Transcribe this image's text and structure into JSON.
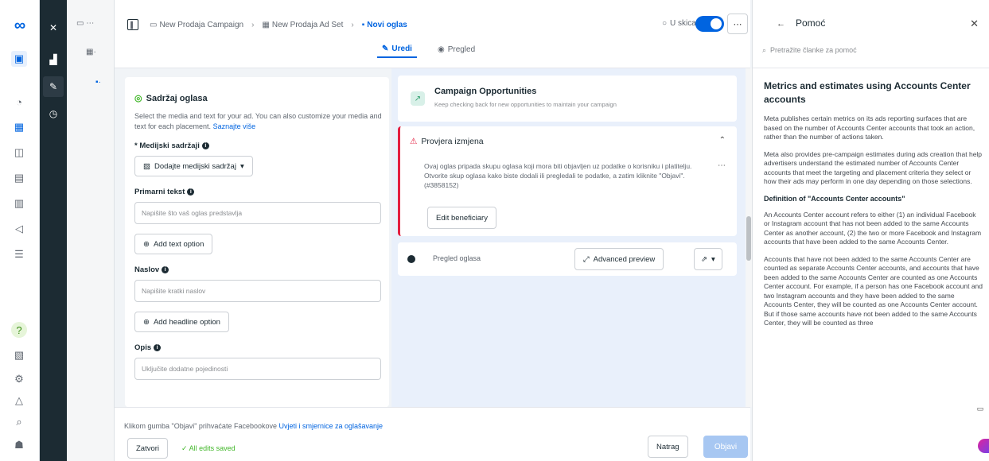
{
  "breadcrumb": {
    "campaign": "New Prodaja Campaign",
    "ad_set": "New Prodaja Ad Set",
    "ad": "Novi oglas"
  },
  "status": {
    "draft": "U skicama"
  },
  "modes": {
    "edit": "Uredi",
    "preview": "Pregled"
  },
  "editor": {
    "section_title": "Sadržaj oglasa",
    "description": "Select the media and text for your ad. You can also customize your media and text for each placement.",
    "learn_more": "Saznajte više",
    "media_label": "* Medijski sadržaji",
    "media_button": "Dodajte medijski sadržaj",
    "primary_label": "Primarni tekst",
    "primary_placeholder": "Napišite što vaš oglas predstavlja",
    "add_text": "Add text option",
    "headline_label": "Naslov",
    "headline_placeholder": "Napišite kratki naslov",
    "add_headline": "Add headline option",
    "desc_label": "Opis",
    "desc_placeholder": "Uključite dodatne pojedinosti"
  },
  "bottom": {
    "terms_prefix": "Klikom gumba \"Objavi\" prihvaćate Facebookove ",
    "terms_link": "Uvjeti i smjernice za oglašavanje",
    "close": "Zatvori",
    "saved": "All edits saved",
    "back": "Natrag",
    "publish": "Objavi"
  },
  "preview": {
    "opps_title": "Campaign Opportunities",
    "opps_desc": "Keep checking back for new opportunities to maintain your campaign",
    "review_title": "Provjera izmjena",
    "review_text": "Ovaj oglas pripada skupu oglasa koji mora biti objavljen uz podatke o korisniku i platitelju. Otvorite skup oglasa kako biste dodali ili pregledali te podatke, a zatim kliknite \"Objavi\". (#3858152)",
    "edit_beneficiary": "Edit beneficiary",
    "preview_label": "Pregled oglasa",
    "advanced_preview": "Advanced preview"
  },
  "help": {
    "title": "Pomoć",
    "search_placeholder": "Pretražite članke za pomoć",
    "heading": "Metrics and estimates using Accounts Center accounts",
    "p1": "Meta publishes certain metrics on its ads reporting surfaces that are based on the number of Accounts Center accounts that took an action, rather than the number of actions taken.",
    "p2": "Meta also provides pre-campaign estimates during ads creation that help advertisers understand the estimated number of Accounts Center accounts that meet the targeting and placement criteria they select or how their ads may perform in one day depending on those selections.",
    "subheading": "Definition of \"Accounts Center accounts\"",
    "p3": "An Accounts Center account refers to either (1) an individual Facebook or Instagram account that has not been added to the same Accounts Center as another account, (2) the two or more Facebook and Instagram accounts that have been added to the same Accounts Center.",
    "p4": "Accounts that have not been added to the same Accounts Center are counted as separate Accounts Center accounts, and accounts that have been added to the same Accounts Center are counted as one Accounts Center account. For example, if a person has one Facebook account and two Instagram accounts and they have been added to the same Accounts Center, they will be counted as one Accounts Center account. But if those same accounts have not been added to the same Accounts Center, they will be counted as three"
  },
  "colors": {
    "accent": "#0064e0",
    "error": "#e41e3f",
    "success": "#42b72a"
  }
}
